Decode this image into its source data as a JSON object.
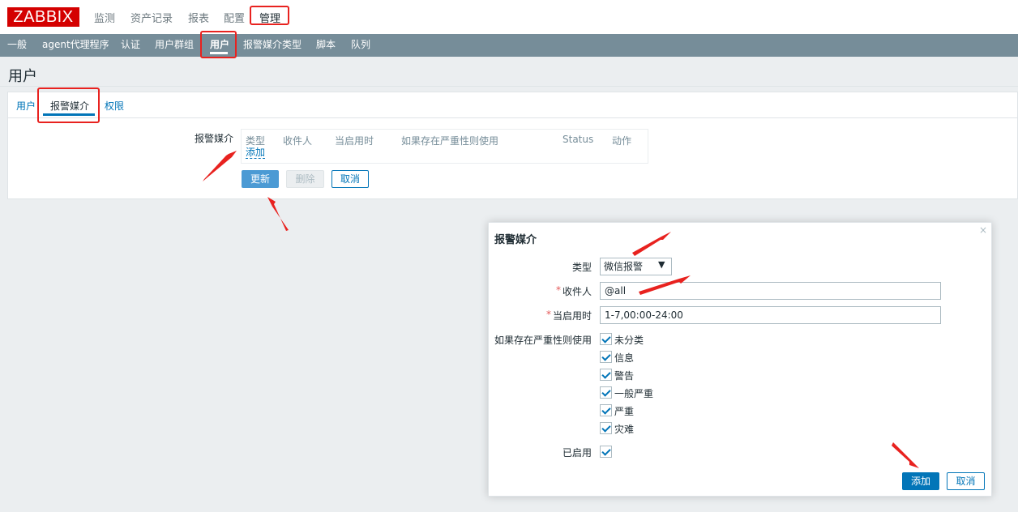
{
  "header": {
    "logo": "ZABBIX",
    "nav": [
      "监测",
      "资产记录",
      "报表",
      "配置",
      "管理"
    ],
    "active_nav": "管理"
  },
  "subnav": {
    "items": [
      "一般",
      "agent代理程序",
      "认证",
      "用户群组",
      "用户",
      "报警媒介类型",
      "脚本",
      "队列"
    ],
    "active": "用户"
  },
  "page": {
    "title": "用户",
    "tabs": [
      "用户",
      "报警媒介",
      "权限"
    ],
    "active_tab": "报警媒介"
  },
  "media_form": {
    "field_label": "报警媒介",
    "columns": [
      "类型",
      "收件人",
      "当启用时",
      "如果存在严重性则使用",
      "Status",
      "动作"
    ],
    "add_link": "添加",
    "buttons": {
      "update": "更新",
      "delete": "删除",
      "cancel": "取消"
    }
  },
  "dialog": {
    "title": "报警媒介",
    "close": "×",
    "type_label": "类型",
    "type_value": "微信报警",
    "type_arrow": "▼",
    "recipient_label": "收件人",
    "recipient_value": "@all",
    "period_label": "当启用时",
    "period_value": "1-7,00:00-24:00",
    "severity_label": "如果存在严重性则使用",
    "severities": [
      {
        "label": "未分类",
        "checked": true
      },
      {
        "label": "信息",
        "checked": true
      },
      {
        "label": "警告",
        "checked": true
      },
      {
        "label": "一般严重",
        "checked": true
      },
      {
        "label": "严重",
        "checked": true
      },
      {
        "label": "灾难",
        "checked": true
      }
    ],
    "enabled_label": "已启用",
    "enabled": true,
    "required_mark": "*",
    "buttons": {
      "add": "添加",
      "cancel": "取消"
    }
  },
  "colors": {
    "brand": "#d40000",
    "subnav_bg": "#768d99",
    "link": "#0275b8",
    "annotation": "#e8221f"
  }
}
